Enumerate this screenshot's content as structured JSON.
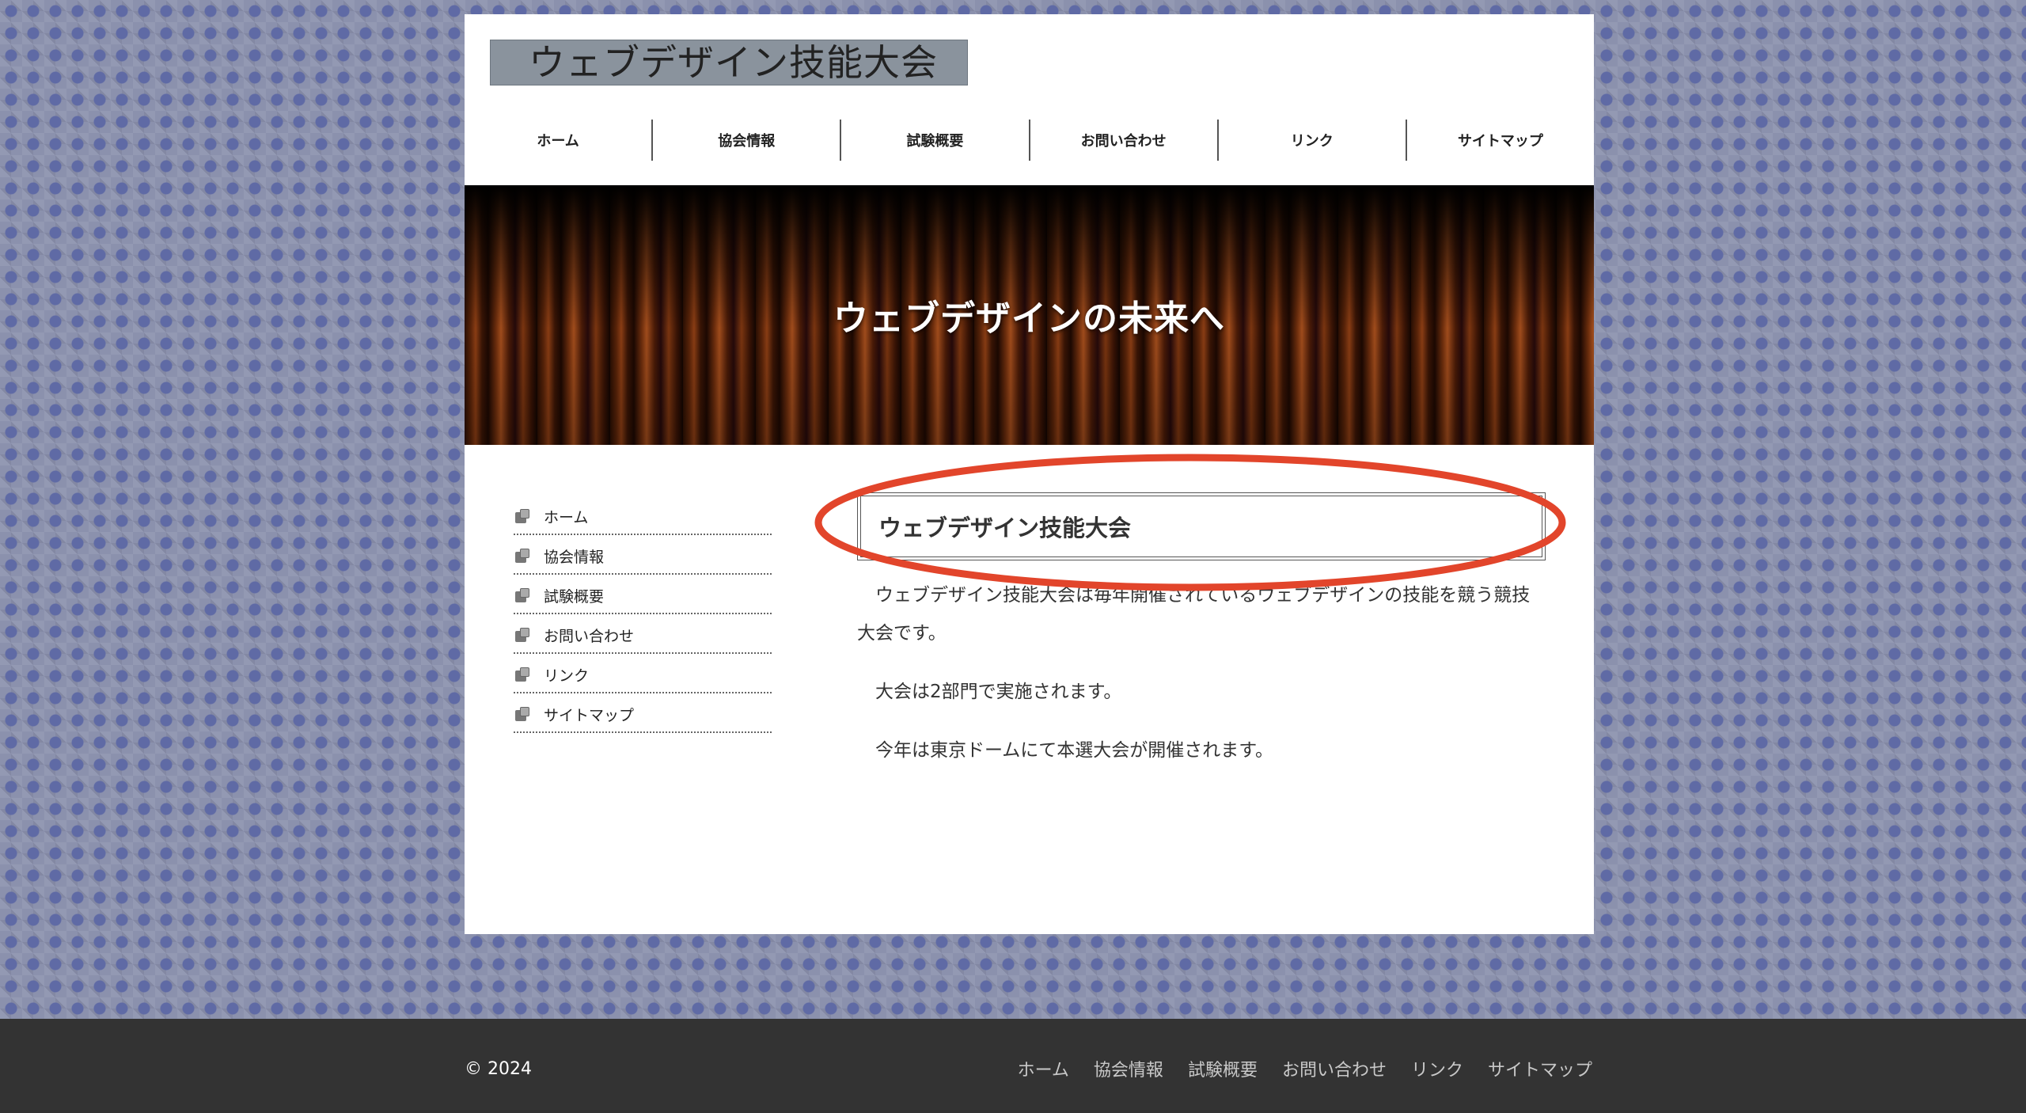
{
  "site": {
    "logo_text": "ウェブデザイン技能大会"
  },
  "nav": {
    "items": [
      {
        "label": "ホーム"
      },
      {
        "label": "協会情報"
      },
      {
        "label": "試験概要"
      },
      {
        "label": "お問い合わせ"
      },
      {
        "label": "リンク"
      },
      {
        "label": "サイトマップ"
      }
    ]
  },
  "hero": {
    "title": "ウェブデザインの未来へ"
  },
  "sidebar": {
    "items": [
      {
        "label": "ホーム",
        "icon": "page-icon"
      },
      {
        "label": "協会情報",
        "icon": "page-icon"
      },
      {
        "label": "試験概要",
        "icon": "page-icon"
      },
      {
        "label": "お問い合わせ",
        "icon": "page-icon"
      },
      {
        "label": "リンク",
        "icon": "page-icon"
      },
      {
        "label": "サイトマップ",
        "icon": "page-icon"
      }
    ]
  },
  "main": {
    "heading": "ウェブデザイン技能大会",
    "paragraphs": [
      "ウェブデザイン技能大会は毎年開催されているウェブデザインの技能を競う競技大会です。",
      "大会は2部門で実施されます。",
      "今年は東京ドームにて本選大会が開催されます。"
    ]
  },
  "footer": {
    "copyright": "© 2024",
    "links": [
      {
        "label": "ホーム"
      },
      {
        "label": "協会情報"
      },
      {
        "label": "試験概要"
      },
      {
        "label": "お問い合わせ"
      },
      {
        "label": "リンク"
      },
      {
        "label": "サイトマップ"
      }
    ]
  },
  "colors": {
    "annotation_ellipse": "#e2452b",
    "footer_bg": "#333333",
    "logo_bg": "#8a939d"
  }
}
